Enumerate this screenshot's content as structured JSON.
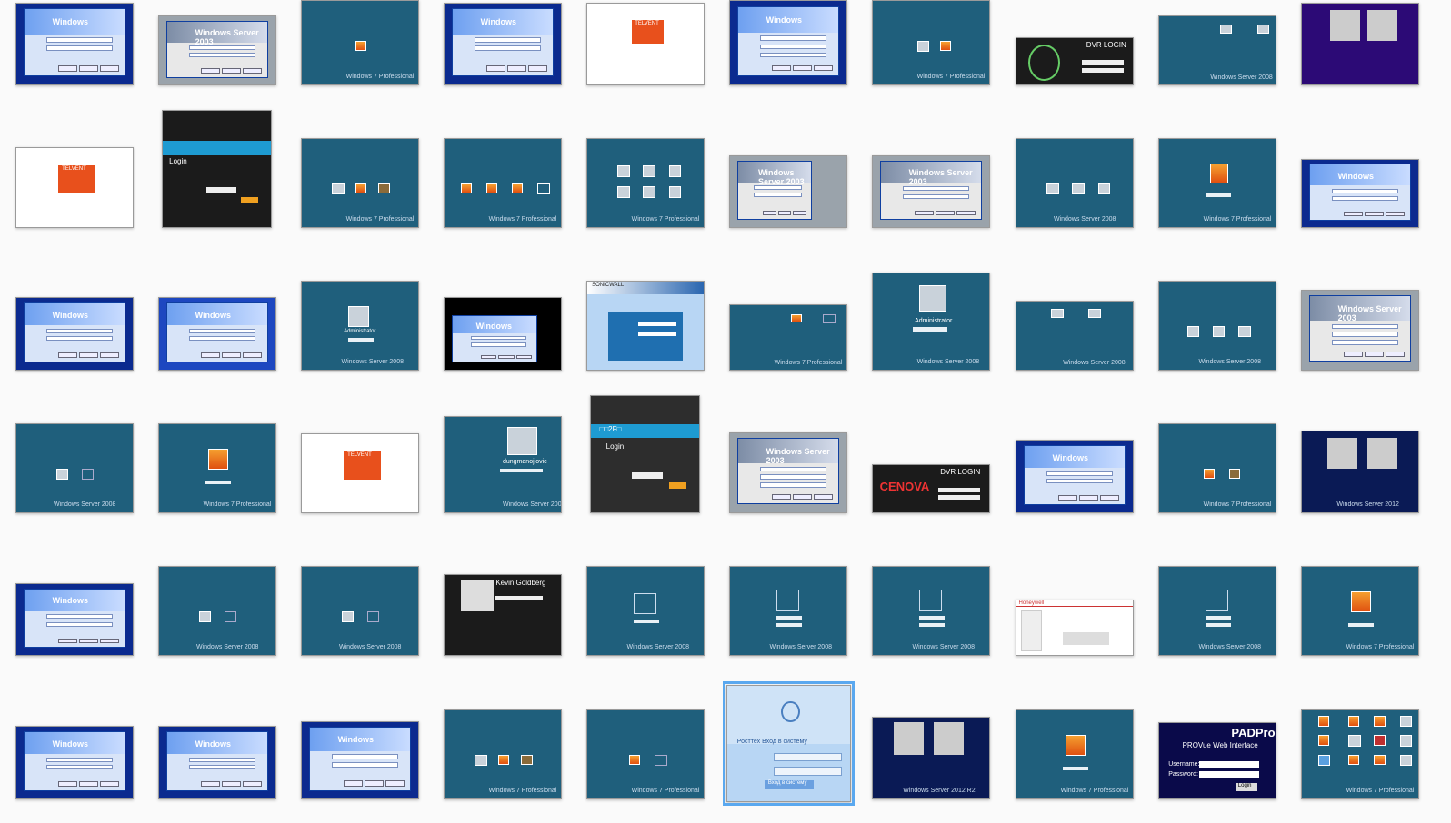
{
  "labels": {
    "windows7_professional": "Windows 7 Professional",
    "windows_server_2008": "Windows Server 2008",
    "windows_server_2003": "Windows Server 2003",
    "windows_server_2012": "Windows Server 2012",
    "windows_server_2012r2": "Windows Server 2012 R2",
    "windows_xp": "Windows",
    "professional": "Professional",
    "telvent": "TELVENT",
    "dvr_login": "DVR LOGIN",
    "cenova": "CENOVA",
    "sonicwall": "SONICWALL",
    "administrator": "Administrator",
    "user_dungmanojlovic": "dungmanojlovic",
    "user_kevin_goldberg": "Kevin Goldberg",
    "login": "Login",
    "russian_login_title": "Росттех Вход в систему",
    "russian_login_button": "Вход в систему",
    "padpro_logo": "PADPro",
    "provue_title": "PROVue Web Interface",
    "username_label": "Username:",
    "password_label": "Password:",
    "login_button": "Login",
    "honeywell": "Honeywell",
    "chinese_banner": "□□2F□"
  }
}
